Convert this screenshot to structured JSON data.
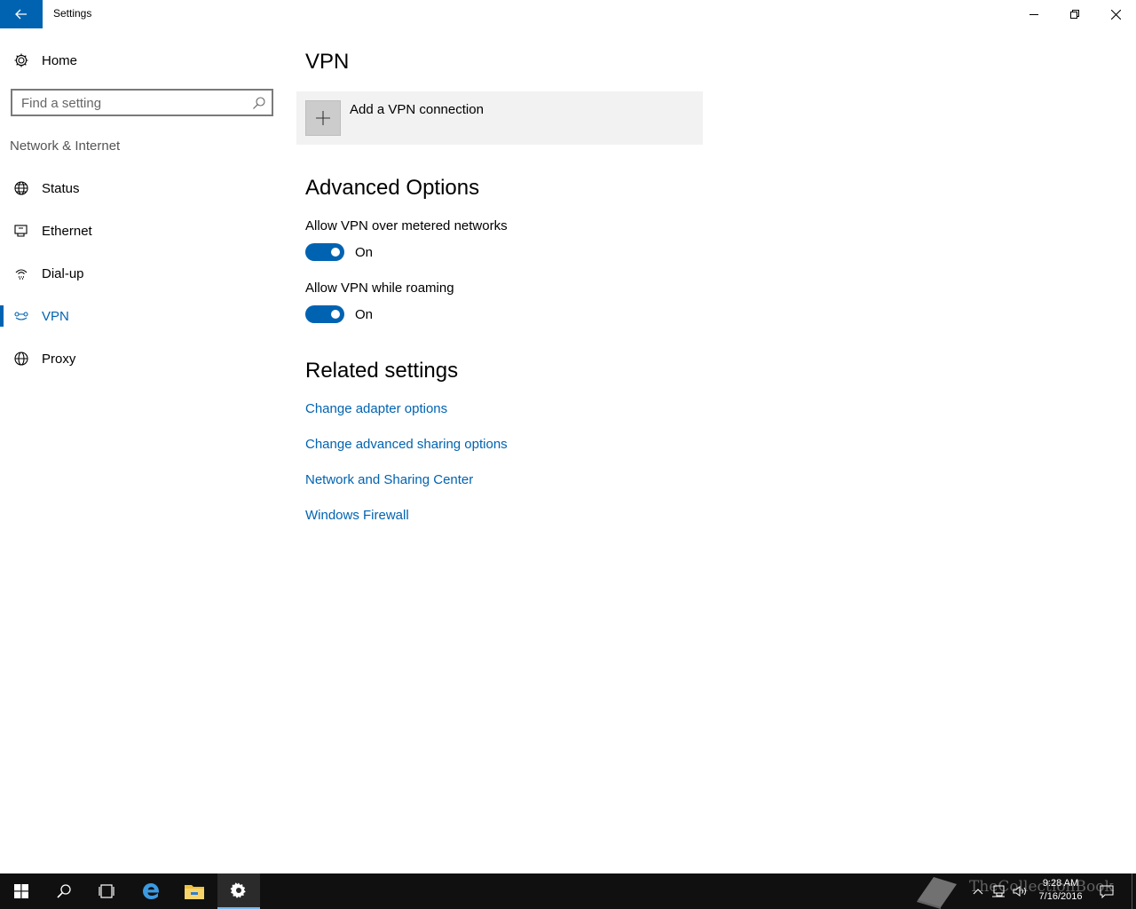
{
  "window": {
    "title": "Settings"
  },
  "sidebar": {
    "home_label": "Home",
    "search_placeholder": "Find a setting",
    "section_header": "Network & Internet",
    "items": [
      {
        "label": "Status",
        "icon": "globe-status-icon",
        "active": false
      },
      {
        "label": "Ethernet",
        "icon": "ethernet-icon",
        "active": false
      },
      {
        "label": "Dial-up",
        "icon": "dialup-icon",
        "active": false
      },
      {
        "label": "VPN",
        "icon": "vpn-icon",
        "active": true
      },
      {
        "label": "Proxy",
        "icon": "globe-icon",
        "active": false
      }
    ]
  },
  "main": {
    "title": "VPN",
    "add_vpn_label": "Add a VPN connection",
    "advanced": {
      "heading": "Advanced Options",
      "options": [
        {
          "label": "Allow VPN over metered networks",
          "state": "On",
          "on": true
        },
        {
          "label": "Allow VPN while roaming",
          "state": "On",
          "on": true
        }
      ]
    },
    "related": {
      "heading": "Related settings",
      "links": [
        "Change adapter options",
        "Change advanced sharing options",
        "Network and Sharing Center",
        "Windows Firewall"
      ]
    }
  },
  "taskbar": {
    "time": "9:28 AM",
    "date": "7/16/2016",
    "watermark": "TheCollectionBook"
  },
  "colors": {
    "accent": "#0063b1",
    "taskbar": "#101010",
    "add_panel": "#f2f2f2"
  }
}
